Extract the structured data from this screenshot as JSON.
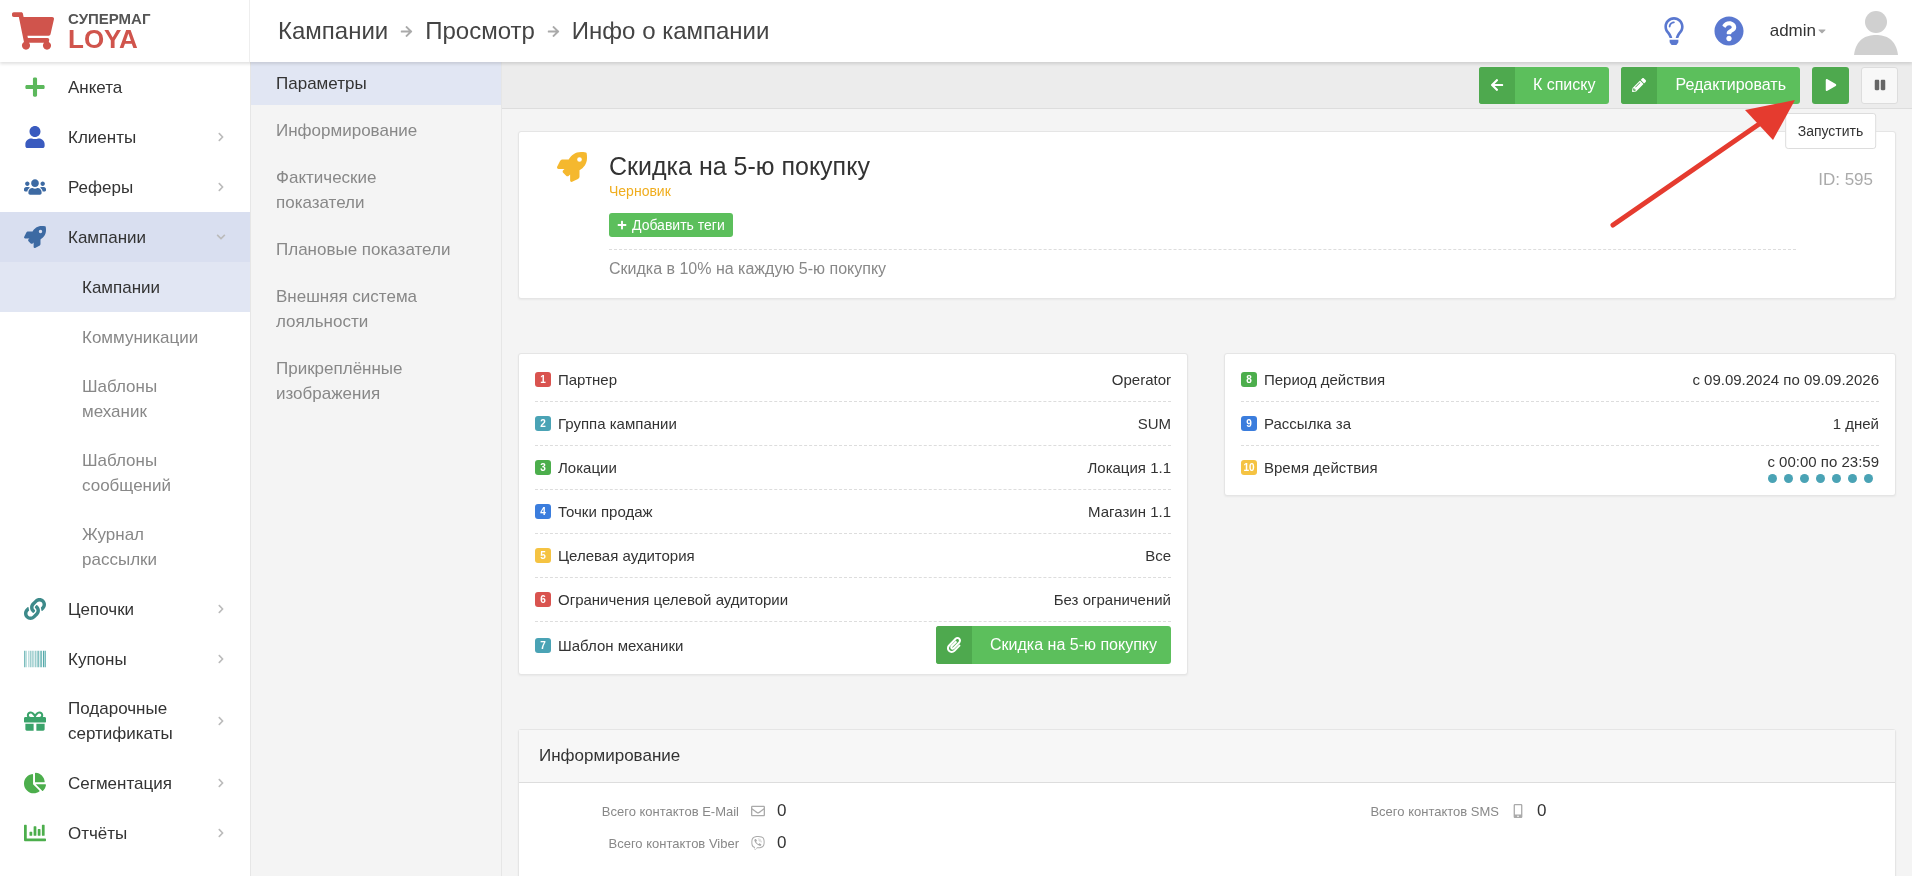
{
  "brand": {
    "line1": "СУПЕРМАГ",
    "line2": "LOYA"
  },
  "breadcrumb": [
    "Кампании",
    "Просмотр",
    "Инфо о кампании"
  ],
  "user": {
    "name": "admin"
  },
  "sidebar": {
    "items": [
      {
        "label": "Анкета",
        "kind": "plain"
      },
      {
        "label": "Клиенты",
        "kind": "group",
        "expanded": false
      },
      {
        "label": "Реферы",
        "kind": "group",
        "expanded": false
      },
      {
        "label": "Кампании",
        "kind": "group",
        "expanded": true,
        "children": [
          {
            "label": "Кампании",
            "selected": true
          },
          {
            "label": "Коммуникации",
            "selected": false
          },
          {
            "label": "Шаблоны механик",
            "selected": false
          },
          {
            "label": "Шаблоны сообщений",
            "selected": false
          },
          {
            "label": "Журнал рассылки",
            "selected": false
          }
        ]
      },
      {
        "label": "Цепочки",
        "kind": "group",
        "expanded": false
      },
      {
        "label": "Купоны",
        "kind": "group",
        "expanded": false
      },
      {
        "label": "Подарочные сертификаты",
        "kind": "group",
        "expanded": false
      },
      {
        "label": "Сегментация",
        "kind": "group",
        "expanded": false
      },
      {
        "label": "Отчёты",
        "kind": "group",
        "expanded": false
      }
    ]
  },
  "subnav": [
    {
      "label": "Параметры",
      "selected": true
    },
    {
      "label": "Информирование",
      "selected": false
    },
    {
      "label": "Фактические показатели",
      "selected": false
    },
    {
      "label": "Плановые показатели",
      "selected": false
    },
    {
      "label": "Внешняя система лояльности",
      "selected": false
    },
    {
      "label": "Прикреплённые изображения",
      "selected": false
    }
  ],
  "toolbar": {
    "buttons": [
      {
        "label": "К списку"
      },
      {
        "label": "Редактировать"
      }
    ],
    "tooltip": "Запустить"
  },
  "campaign": {
    "title": "Скидка на 5-ю покупку",
    "status": "Черновик",
    "tag_button": "Добавить теги",
    "description": "Скидка в 10% на каждую 5-ю покупку",
    "id": "ID: 595"
  },
  "params_left": [
    {
      "number": "1",
      "label": "Партнер",
      "value": "Operator",
      "color": "#d9534f",
      "kind": "text"
    },
    {
      "number": "2",
      "label": "Группа кампании",
      "value": "SUM",
      "color": "#4aa3b5",
      "kind": "text"
    },
    {
      "number": "3",
      "label": "Локации",
      "value": "Локация 1.1",
      "color": "#4cae4c",
      "kind": "text"
    },
    {
      "number": "4",
      "label": "Точки продаж",
      "value": "Магазин 1.1",
      "color": "#3b7ddd",
      "kind": "text"
    },
    {
      "number": "5",
      "label": "Целевая аудитория",
      "value": "Все",
      "color": "#f5c342",
      "kind": "text"
    },
    {
      "number": "6",
      "label": "Ограничения целевой аудитории",
      "value": "Без ограничений",
      "color": "#d9534f",
      "kind": "text"
    },
    {
      "number": "7",
      "label": "Шаблон механики",
      "value": "Скидка на 5-ю покупку",
      "color": "#4aa3b5",
      "kind": "button"
    }
  ],
  "params_right": [
    {
      "number": "8",
      "label": "Период действия",
      "value": "с 09.09.2024 по 09.09.2026",
      "color": "#4cae4c",
      "kind": "text"
    },
    {
      "number": "9",
      "label": "Рассылка за",
      "value": "1 дней",
      "color": "#3b7ddd",
      "kind": "text"
    },
    {
      "number": "10",
      "label": "Время действия",
      "value": "с 00:00 по 23:59",
      "color": "#f5c342",
      "kind": "days",
      "days": [
        {
          "on": true
        },
        {
          "on": true
        },
        {
          "on": true
        },
        {
          "on": true
        },
        {
          "on": true
        },
        {
          "on": true
        },
        {
          "on": true
        }
      ]
    }
  ],
  "informing": {
    "title": "Информирование",
    "stats": [
      {
        "label": "Всего контактов E-Mail",
        "value": "0"
      },
      {
        "label": "Всего контактов SMS",
        "value": "0"
      },
      {
        "label": "Всего контактов Viber",
        "value": "0"
      }
    ]
  }
}
